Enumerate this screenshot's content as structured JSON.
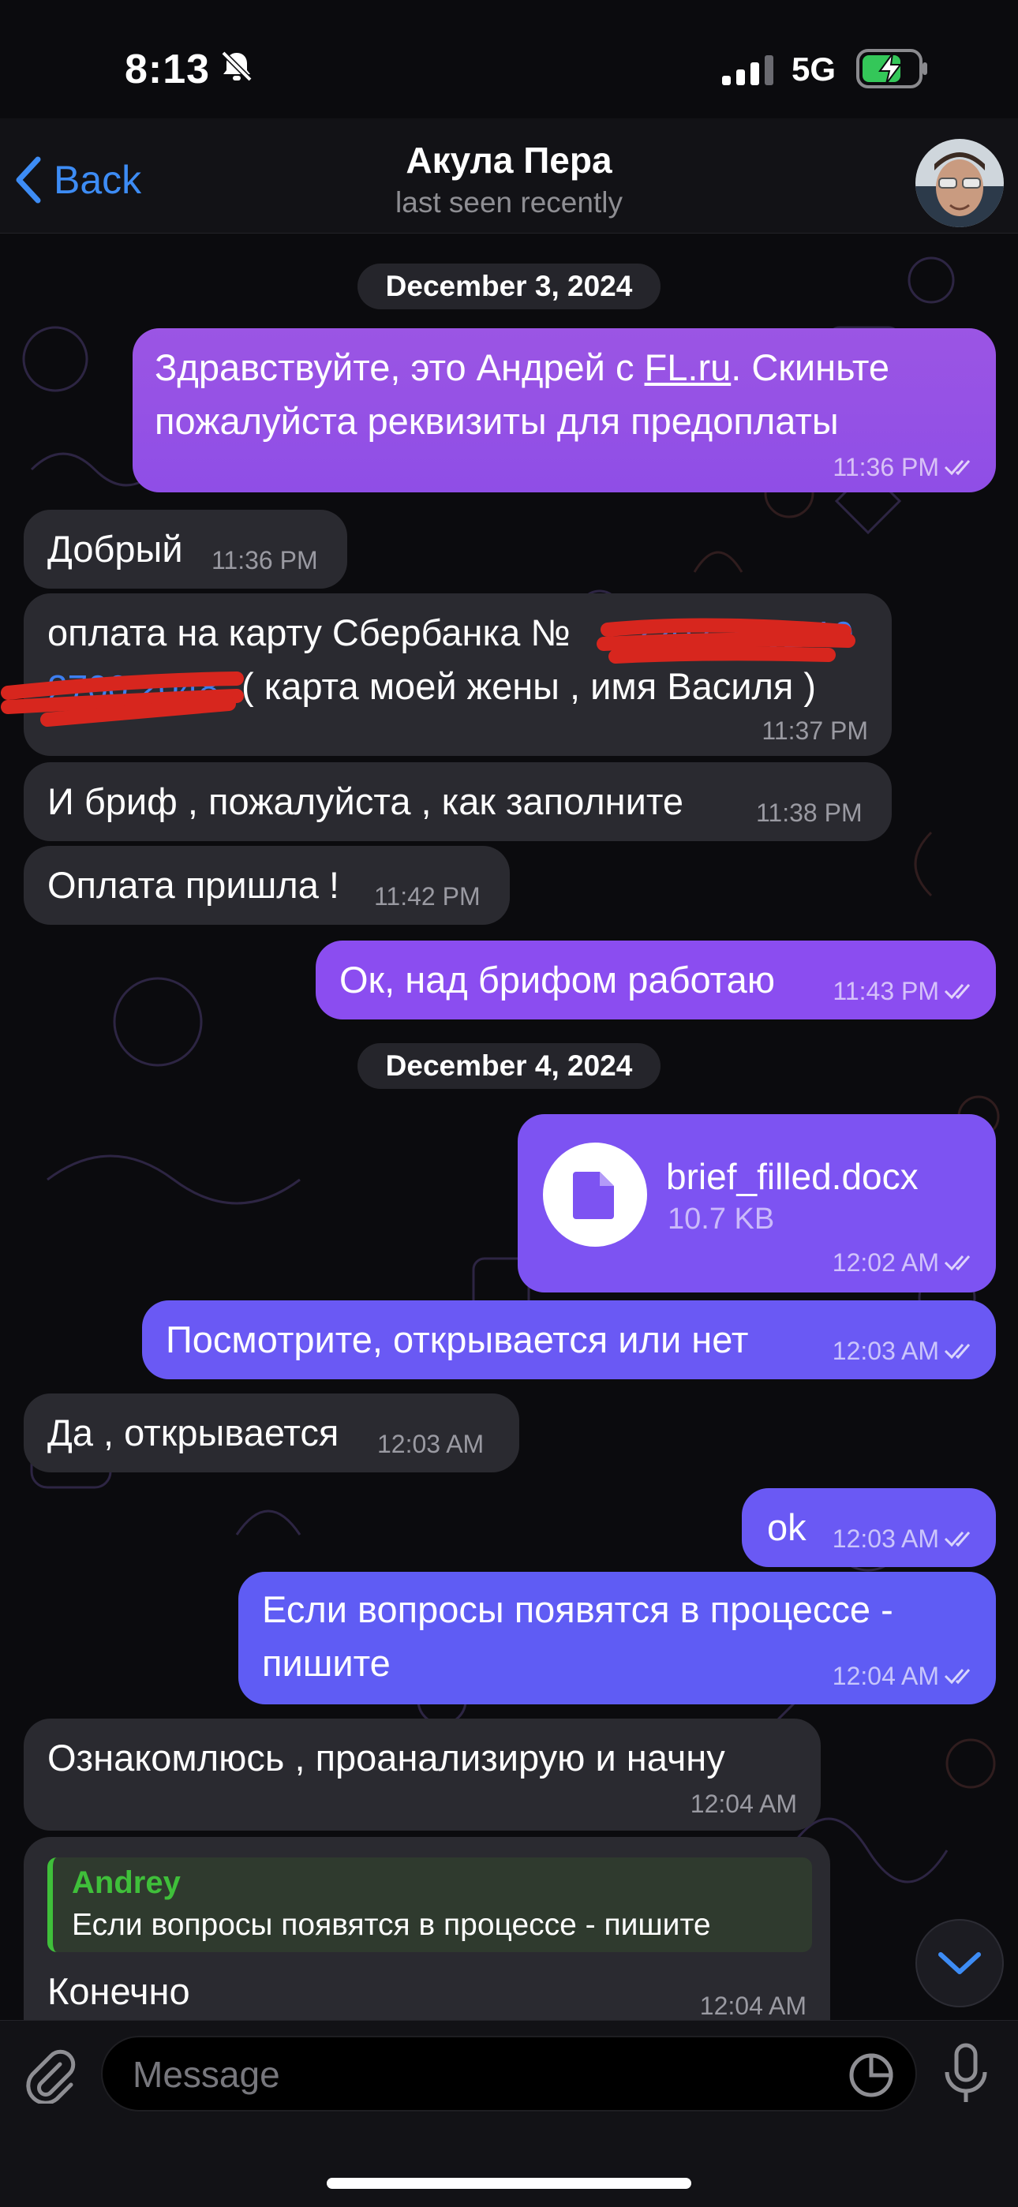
{
  "status_bar": {
    "time": "8:13",
    "network": "5G"
  },
  "header": {
    "back_label": "Back",
    "title": "Акула Пера",
    "subtitle": "last seen recently"
  },
  "dates": [
    "December 3, 2024",
    "December 4, 2024"
  ],
  "messages": [
    {
      "dir": "out",
      "line1_a": "Здравствуйте, это Андрей с ",
      "line1_link": "FL.ru",
      "line1_b": ". Скиньте",
      "line2": "пожалуйста реквизиты для предоплаты",
      "time": "11:36 PM"
    },
    {
      "dir": "in",
      "text": "Добрый",
      "time": "11:36 PM"
    },
    {
      "dir": "in",
      "line1": "оплата на карту Сбербанка №",
      "line2": "( карта моей жены , имя Василя )",
      "time": "11:37 PM"
    },
    {
      "dir": "in",
      "text": "И бриф , пожалуйста , как заполните",
      "time": "11:38 PM"
    },
    {
      "dir": "in",
      "text": "Оплата пришла !",
      "time": "11:42 PM"
    },
    {
      "dir": "out",
      "text": "Ок, над брифом работаю",
      "time": "11:43 PM"
    },
    {
      "dir": "out",
      "file_name": "brief_filled.docx",
      "file_size": "10.7 KB",
      "time": "12:02 AM"
    },
    {
      "dir": "out",
      "text": "Посмотрите, открывается или нет",
      "time": "12:03 AM"
    },
    {
      "dir": "in",
      "text": "Да , открывается",
      "time": "12:03 AM"
    },
    {
      "dir": "out",
      "text": "ok",
      "time": "12:03 AM"
    },
    {
      "dir": "out",
      "line1": "Если вопросы появятся в процессе -",
      "line2": "пишите",
      "time": "12:04 AM"
    },
    {
      "dir": "in",
      "text": "Ознакомлюсь , проанализирую и начну",
      "time": "12:04 AM"
    },
    {
      "dir": "in",
      "reply_author": "Andrey",
      "reply_text": "Если вопросы появятся в процессе - пишите",
      "text": "Конечно",
      "time": "12:04 AM"
    }
  ],
  "input": {
    "placeholder": "Message"
  },
  "colors": {
    "accent": "#3d8cf5",
    "incoming_bubble": "#2a2a30",
    "outgoing_top": "#9b55e4",
    "outgoing_bottom": "#5f5cf4",
    "reply_author": "#3fbf3a",
    "redaction": "#d7261e"
  },
  "icons": [
    "muted-bell-icon",
    "signal-icon",
    "battery-charging-icon",
    "back-chevron-icon",
    "double-check-icon",
    "document-icon",
    "attachment-icon",
    "sticker-icon",
    "microphone-icon",
    "chevron-down-icon"
  ]
}
